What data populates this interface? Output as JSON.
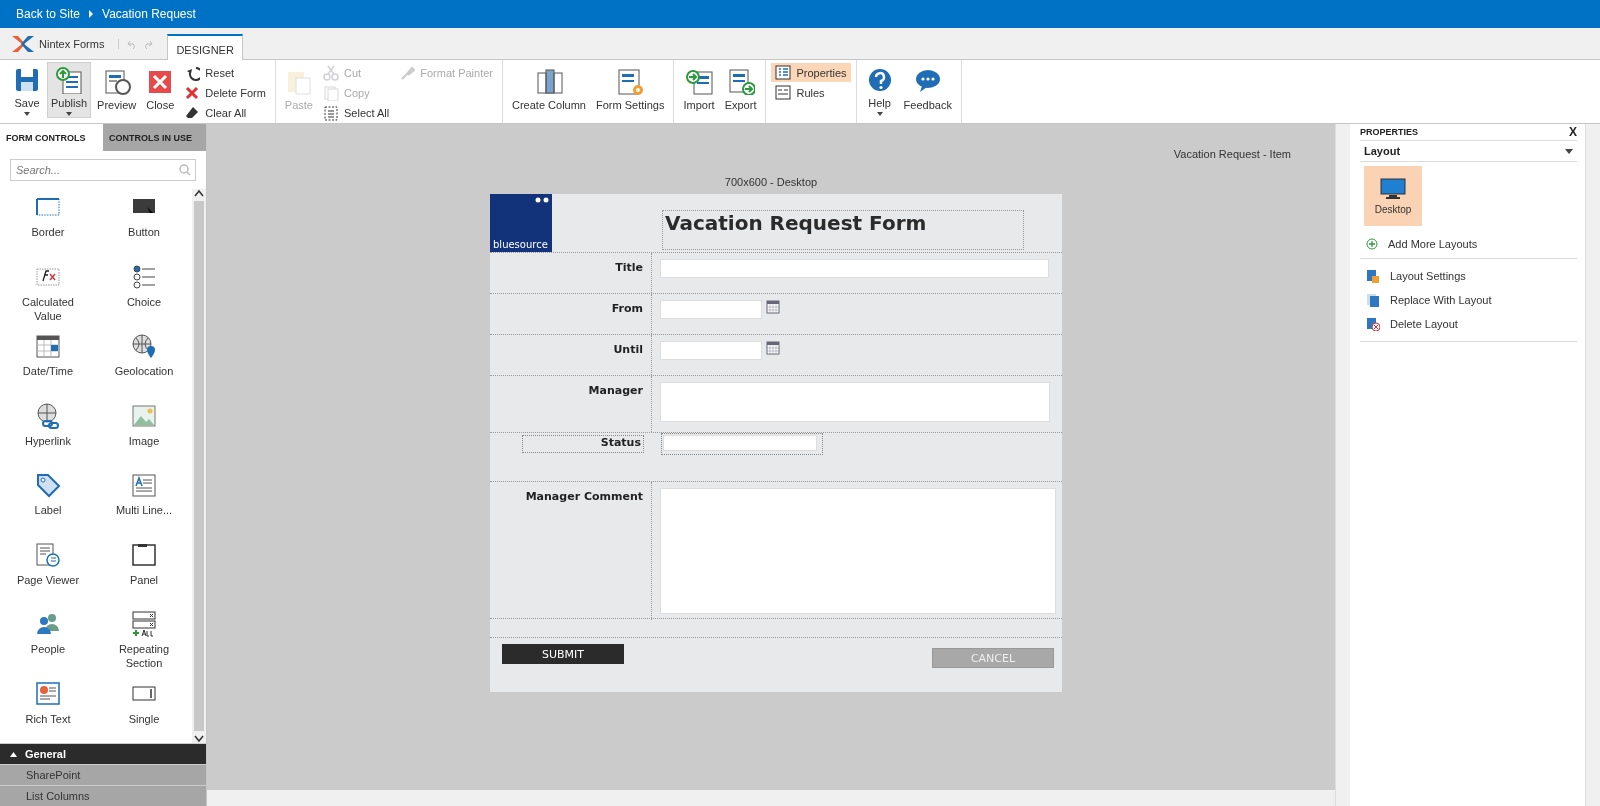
{
  "breadcrumb": [
    "Back to Site",
    "Vacation Request"
  ],
  "app": {
    "brand": "Nintex Forms",
    "tabs": [
      {
        "label": "DESIGNER",
        "selected": true
      }
    ]
  },
  "ribbon": {
    "groups": [
      {
        "items": [
          {
            "kind": "large",
            "label": "Save",
            "dropdown": true,
            "selected": false,
            "disabled": false
          },
          {
            "kind": "large",
            "label": "Publish",
            "dropdown": true,
            "selected": true,
            "disabled": false
          },
          {
            "kind": "large",
            "label": "Preview",
            "dropdown": false,
            "selected": false,
            "disabled": false
          },
          {
            "kind": "large",
            "label": "Close",
            "dropdown": false,
            "selected": false,
            "disabled": false
          },
          {
            "kind": "small",
            "label": "Reset",
            "selected": false,
            "disabled": false
          },
          {
            "kind": "small",
            "label": "Delete Form",
            "selected": false,
            "disabled": false
          },
          {
            "kind": "small",
            "label": "Clear All",
            "selected": false,
            "disabled": false
          }
        ]
      },
      {
        "items": [
          {
            "kind": "large",
            "label": "Paste",
            "dropdown": false,
            "selected": false,
            "disabled": true
          },
          {
            "kind": "small",
            "label": "Cut",
            "selected": false,
            "disabled": true
          },
          {
            "kind": "small",
            "label": "Copy",
            "selected": false,
            "disabled": true
          },
          {
            "kind": "small",
            "label": "Select All",
            "selected": false,
            "disabled": false
          },
          {
            "kind": "top",
            "label": "Format Painter",
            "selected": false,
            "disabled": true
          }
        ]
      },
      {
        "items": [
          {
            "kind": "large",
            "label": "Create Column",
            "dropdown": false,
            "selected": false,
            "disabled": false
          },
          {
            "kind": "large",
            "label": "Form Settings",
            "dropdown": false,
            "selected": false,
            "disabled": false
          }
        ]
      },
      {
        "items": [
          {
            "kind": "large",
            "label": "Import",
            "dropdown": false,
            "selected": false,
            "disabled": false
          },
          {
            "kind": "large",
            "label": "Export",
            "dropdown": false,
            "selected": false,
            "disabled": false
          }
        ]
      },
      {
        "items": [
          {
            "kind": "small",
            "label": "Properties",
            "selected": true,
            "disabled": false
          },
          {
            "kind": "small",
            "label": "Rules",
            "selected": false,
            "disabled": false
          }
        ]
      },
      {
        "items": [
          {
            "kind": "large",
            "label": "Help",
            "dropdown": true,
            "selected": false,
            "disabled": false
          },
          {
            "kind": "large",
            "label": "Feedback",
            "dropdown": false,
            "selected": false,
            "disabled": false
          }
        ]
      }
    ]
  },
  "left_panel": {
    "tabs": [
      {
        "label": "FORM CONTROLS",
        "selected": true
      },
      {
        "label": "CONTROLS IN USE",
        "selected": false
      }
    ],
    "search": {
      "placeholder": "Search..."
    },
    "controls": [
      {
        "label": "Border"
      },
      {
        "label": "Button"
      },
      {
        "label": "Calculated Value"
      },
      {
        "label": "Choice"
      },
      {
        "label": "Date/Time"
      },
      {
        "label": "Geolocation"
      },
      {
        "label": "Hyperlink"
      },
      {
        "label": "Image"
      },
      {
        "label": "Label"
      },
      {
        "label": "Multi Line..."
      },
      {
        "label": "Page Viewer"
      },
      {
        "label": "Panel"
      },
      {
        "label": "People"
      },
      {
        "label": "Repeating Section"
      },
      {
        "label": "Rich Text"
      },
      {
        "label": "Single"
      }
    ],
    "categories": [
      {
        "label": "General",
        "expanded": true
      },
      {
        "label": "SharePoint",
        "expanded": false
      },
      {
        "label": "List Columns",
        "expanded": false
      }
    ]
  },
  "canvas": {
    "item_title": "Vacation Request - Item",
    "layout_title": "700x600 - Desktop",
    "form": {
      "logo_text": "bluesource",
      "title": "Vacation Request Form",
      "rows": [
        {
          "label": "Title",
          "kind": "text"
        },
        {
          "label": "From",
          "kind": "date"
        },
        {
          "label": "Until",
          "kind": "date"
        },
        {
          "label": "Manager",
          "kind": "people"
        },
        {
          "label": "Status",
          "kind": "status"
        },
        {
          "label": "Manager Comment",
          "kind": "multiline"
        }
      ],
      "buttons": [
        {
          "label": "SUBMIT",
          "kind": "primary"
        },
        {
          "label": "CANCEL",
          "kind": "secondary"
        }
      ]
    }
  },
  "properties": {
    "title": "PROPERTIES",
    "close": "X",
    "section": "Layout",
    "layouts": [
      {
        "label": "Desktop",
        "selected": true
      }
    ],
    "add_label": "Add More Layouts",
    "actions": [
      {
        "label": "Layout Settings"
      },
      {
        "label": "Replace With Layout"
      },
      {
        "label": "Delete Layout"
      }
    ]
  }
}
